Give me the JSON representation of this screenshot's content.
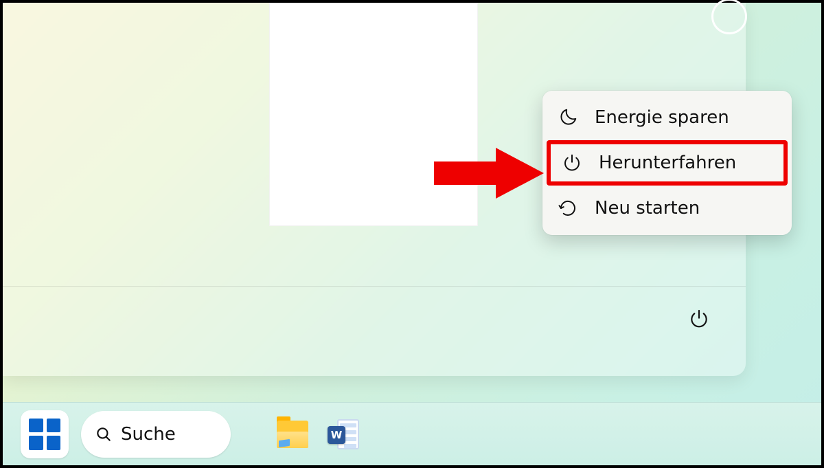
{
  "power_menu": {
    "sleep_label": "Energie sparen",
    "shutdown_label": "Herunterfahren",
    "restart_label": "Neu starten",
    "highlighted": "shutdown",
    "icons": {
      "sleep": "moon-icon",
      "shutdown": "power-icon",
      "restart": "restart-icon"
    }
  },
  "start_footer": {
    "power_button_icon": "power-icon"
  },
  "taskbar": {
    "search_placeholder": "Suche",
    "items": [
      {
        "name": "start",
        "icon": "windows-logo-icon"
      },
      {
        "name": "search",
        "icon": "search-icon"
      },
      {
        "name": "file-explorer",
        "icon": "folder-icon"
      },
      {
        "name": "word",
        "icon": "word-icon",
        "badge": "W"
      }
    ]
  },
  "annotation": {
    "arrow_color": "#ee0000",
    "highlight_color": "#ee0000"
  }
}
